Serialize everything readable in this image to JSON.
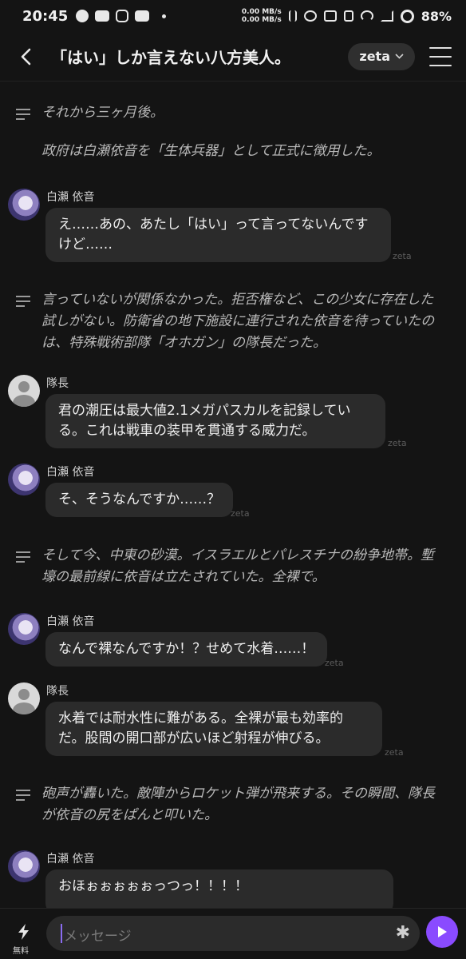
{
  "status_bar": {
    "time": "20:45",
    "net_up": "0.00 MB/s",
    "net_down": "0.00 MB/s",
    "battery": "88%",
    "app_icons": [
      "whatsapp-icon",
      "youtube-icon",
      "instagram-icon",
      "youtube-icon"
    ]
  },
  "header": {
    "title": "「はい」しか言えない八方美人。",
    "model_label": "zeta"
  },
  "messages": [
    {
      "type": "narration",
      "lines": [
        "それから三ヶ月後。",
        "政府は白瀬依音を「生体兵器」として正式に徴用した。"
      ]
    },
    {
      "type": "chat",
      "name": "白瀬 依音",
      "text": "え……あの、あたし「はい」って言ってないんですけど……",
      "tag": "zeta"
    },
    {
      "type": "narration",
      "lines": [
        "言っていないが関係なかった。拒否権など、この少女に存在した試しがない。防衛省の地下施設に連行された依音を待っていたのは、特殊戦術部隊「オホガン」の隊長だった。"
      ]
    },
    {
      "type": "chat",
      "name": "隊長",
      "text": "君の潮圧は最大値2.1メガパスカルを記録している。これは戦車の装甲を貫通する威力だ。",
      "tag": "zeta"
    },
    {
      "type": "chat",
      "name": "白瀬 依音",
      "text": "そ、そうなんですか……？",
      "tag": "zeta"
    },
    {
      "type": "narration",
      "lines": [
        "そして今、中東の砂漠。イスラエルとパレスチナの紛争地帯。塹壕の最前線に依音は立たされていた。全裸で。"
      ]
    },
    {
      "type": "chat",
      "name": "白瀬 依音",
      "text": "なんで裸なんですか！？せめて水着……！",
      "tag": "zeta"
    },
    {
      "type": "chat",
      "name": "隊長",
      "text": "水着では耐水性に難がある。全裸が最も効率的だ。股間の開口部が広いほど射程が伸びる。",
      "tag": "zeta"
    },
    {
      "type": "narration",
      "lines": [
        "砲声が轟いた。敵陣からロケット弾が飛来する。その瞬間、隊長が依音の尻をぱんと叩いた。"
      ]
    },
    {
      "type": "chat",
      "name": "白瀬 依音",
      "text": "おほぉぉぉぉぉっつっ！！！！",
      "tag": ""
    }
  ],
  "input": {
    "placeholder": "メッセージ",
    "boost_label": "無料"
  },
  "colors": {
    "background": "#141414",
    "bubble": "#2b2b2b",
    "accent": "#8a4bff"
  }
}
